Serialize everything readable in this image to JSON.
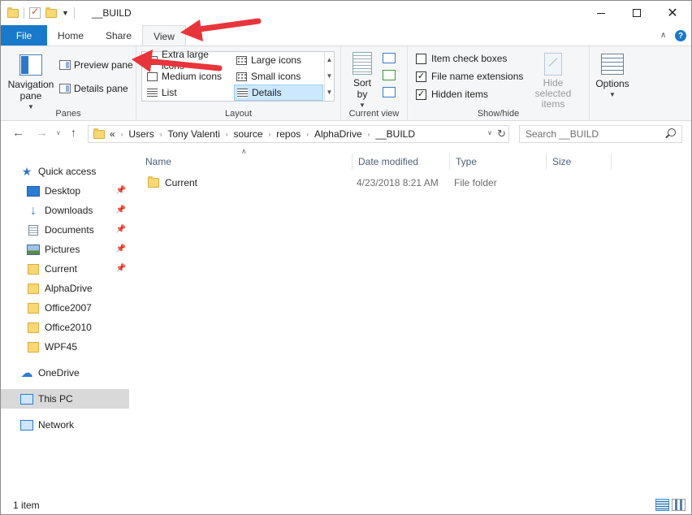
{
  "window": {
    "title": "__BUILD"
  },
  "ribbon_tabs": {
    "file": "File",
    "home": "Home",
    "share": "Share",
    "view": "View"
  },
  "ribbon": {
    "panes": {
      "label": "Panes",
      "navigation_pane": "Navigation pane",
      "preview_pane": "Preview pane",
      "details_pane": "Details pane"
    },
    "layout": {
      "label": "Layout",
      "items": [
        "Extra large icons",
        "Large icons",
        "Medium icons",
        "Small icons",
        "List",
        "Details"
      ],
      "selected": "Details"
    },
    "current_view": {
      "label": "Current view",
      "sort_by": "Sort by"
    },
    "show_hide": {
      "label": "Show/hide",
      "item_check_boxes": "Item check boxes",
      "item_check_boxes_checked": false,
      "file_name_extensions": "File name extensions",
      "file_name_extensions_checked": true,
      "hidden_items": "Hidden items",
      "hidden_items_checked": true,
      "hide_selected_items": "Hide selected items"
    },
    "options": {
      "label": "Options"
    }
  },
  "address": {
    "overflow": "«",
    "breadcrumbs": [
      "Users",
      "Tony Valenti",
      "source",
      "repos",
      "AlphaDrive",
      "__BUILD"
    ]
  },
  "search": {
    "placeholder": "Search __BUILD"
  },
  "sidebar": {
    "items": [
      {
        "label": "Quick access",
        "icon": "star-icon",
        "pinned": false
      },
      {
        "label": "Desktop",
        "icon": "desktop-icon",
        "pinned": true
      },
      {
        "label": "Downloads",
        "icon": "downloads-icon",
        "pinned": true
      },
      {
        "label": "Documents",
        "icon": "documents-icon",
        "pinned": true
      },
      {
        "label": "Pictures",
        "icon": "pictures-icon",
        "pinned": true
      },
      {
        "label": "Current",
        "icon": "folder-icon",
        "pinned": true
      },
      {
        "label": "AlphaDrive",
        "icon": "folder-icon",
        "pinned": false
      },
      {
        "label": "Office2007",
        "icon": "folder-icon",
        "pinned": false
      },
      {
        "label": "Office2010",
        "icon": "folder-icon",
        "pinned": false
      },
      {
        "label": "WPF45",
        "icon": "folder-icon",
        "pinned": false
      },
      {
        "label": "OneDrive",
        "icon": "onedrive-icon",
        "pinned": false
      },
      {
        "label": "This PC",
        "icon": "this-pc-icon",
        "pinned": false
      },
      {
        "label": "Network",
        "icon": "network-icon",
        "pinned": false
      }
    ],
    "selected": "This PC"
  },
  "file_list": {
    "columns": [
      "Name",
      "Date modified",
      "Type",
      "Size"
    ],
    "rows": [
      {
        "name": "Current",
        "date_modified": "4/23/2018 8:21 AM",
        "type": "File folder",
        "size": ""
      }
    ]
  },
  "status": {
    "item_count": "1 item"
  },
  "colors": {
    "accent": "#1979ca",
    "annotation_arrow": "#e8353b",
    "selection": "#cce8ff"
  }
}
